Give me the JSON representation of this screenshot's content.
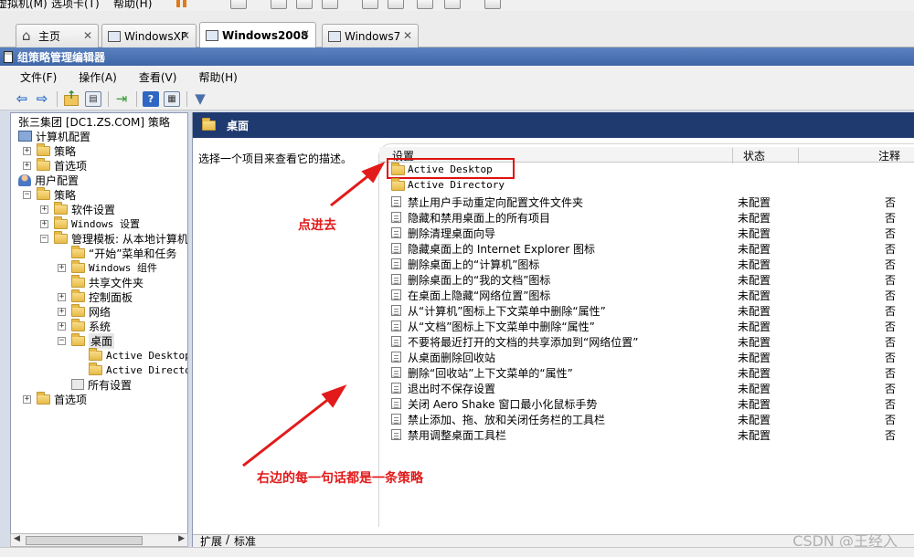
{
  "host": {
    "menu": [
      "虚拟机(M)",
      "选项卡(T)",
      "帮助(H)"
    ],
    "tabs": [
      {
        "label": "主页",
        "icon": "home-icon"
      },
      {
        "label": "WindowsXP",
        "icon": "vm-icon"
      },
      {
        "label": "Windows2008",
        "icon": "vm-icon",
        "active": true
      },
      {
        "label": "Windows7",
        "icon": "vm-icon"
      }
    ]
  },
  "window": {
    "title": "组策略管理编辑器",
    "menu": [
      "文件(F)",
      "操作(A)",
      "查看(V)",
      "帮助(H)"
    ]
  },
  "tree": {
    "root": "张三集团 [DC1.ZS.COM] 策略",
    "computer_config": "计算机配置",
    "policies": "策略",
    "preferences": "首选项",
    "user_config": "用户配置",
    "user_policies": "策略",
    "software_settings": "软件设置",
    "windows_settings": "Windows 设置",
    "admin_templates": "管理模板: 从本地计算机",
    "start_menu": "“开始”菜单和任务",
    "windows_components": "Windows 组件",
    "shared_folders": "共享文件夹",
    "control_panel": "控制面板",
    "network": "网络",
    "system": "系统",
    "desktop": "桌面",
    "active_desktop": "Active Desktop",
    "active_directory": "Active Director",
    "all_settings": "所有设置",
    "user_preferences": "首选项"
  },
  "right": {
    "header": "桌面",
    "description": "选择一个项目来查看它的描述。",
    "columns": {
      "setting": "设置",
      "state": "状态",
      "note": "注释"
    },
    "folders": [
      "Active Desktop",
      "Active Directory"
    ],
    "rows": [
      {
        "name": "禁止用户手动重定向配置文件文件夹",
        "state": "未配置",
        "note": "否"
      },
      {
        "name": "隐藏和禁用桌面上的所有项目",
        "state": "未配置",
        "note": "否"
      },
      {
        "name": "删除清理桌面向导",
        "state": "未配置",
        "note": "否"
      },
      {
        "name": "隐藏桌面上的 Internet Explorer 图标",
        "state": "未配置",
        "note": "否"
      },
      {
        "name": "删除桌面上的“计算机”图标",
        "state": "未配置",
        "note": "否"
      },
      {
        "name": "删除桌面上的“我的文档”图标",
        "state": "未配置",
        "note": "否"
      },
      {
        "name": "在桌面上隐藏“网络位置”图标",
        "state": "未配置",
        "note": "否"
      },
      {
        "name": "从“计算机”图标上下文菜单中删除“属性”",
        "state": "未配置",
        "note": "否"
      },
      {
        "name": "从“文档”图标上下文菜单中删除“属性”",
        "state": "未配置",
        "note": "否"
      },
      {
        "name": "不要将最近打开的文档的共享添加到“网络位置”",
        "state": "未配置",
        "note": "否"
      },
      {
        "name": "从桌面删除回收站",
        "state": "未配置",
        "note": "否"
      },
      {
        "name": "删除“回收站”上下文菜单的“属性”",
        "state": "未配置",
        "note": "否"
      },
      {
        "name": "退出时不保存设置",
        "state": "未配置",
        "note": "否"
      },
      {
        "name": "关闭 Aero Shake 窗口最小化鼠标手势",
        "state": "未配置",
        "note": "否"
      },
      {
        "name": "禁止添加、拖、放和关闭任务栏的工具栏",
        "state": "未配置",
        "note": "否"
      },
      {
        "name": "禁用调整桌面工具栏",
        "state": "未配置",
        "note": "否"
      }
    ],
    "bottom_tabs": [
      "扩展",
      "标准"
    ]
  },
  "annotations": {
    "click_in": "点进去",
    "each_line": "右边的每一句话都是一条策略"
  },
  "watermark": "CSDN @王经入",
  "colors": {
    "accent": "#1f3a6e",
    "annotation": "#e21a1a",
    "titlebar": "#4a72b5"
  }
}
